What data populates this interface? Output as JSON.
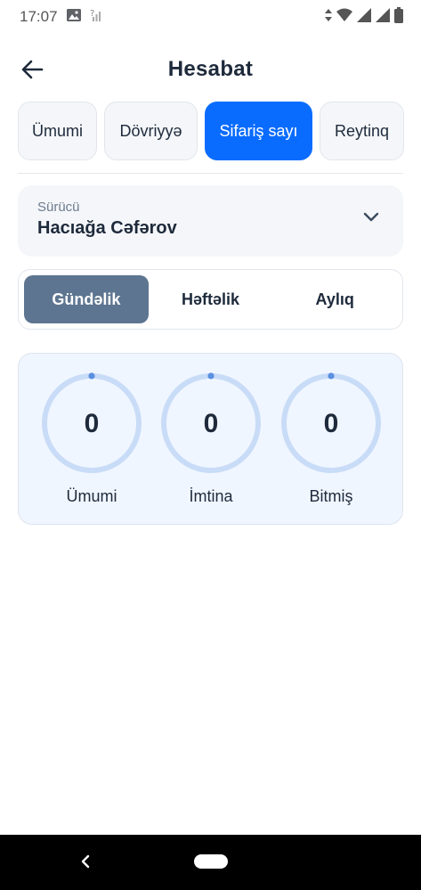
{
  "status_bar": {
    "time": "17:07"
  },
  "header": {
    "title": "Hesabat"
  },
  "tabs": [
    {
      "label": "Ümumi",
      "active": false
    },
    {
      "label": "Dövriyyə",
      "active": false
    },
    {
      "label": "Sifariş sayı",
      "active": true
    },
    {
      "label": "Reytinq",
      "active": false
    }
  ],
  "driver": {
    "label": "Sürücü",
    "value": "Hacıağa Cəfərov"
  },
  "period": {
    "options": [
      "Gündəlik",
      "Həftəlik",
      "Aylıq"
    ],
    "selected": "Gündəlik"
  },
  "stats": [
    {
      "label": "Ümumi",
      "value": "0"
    },
    {
      "label": "İmtina",
      "value": "0"
    },
    {
      "label": "Bitmiş",
      "value": "0"
    }
  ],
  "colors": {
    "accent": "#0a6cff",
    "period_active": "#5d7590",
    "ring_track": "#c9dcf7",
    "ring_dot": "#5b8fe0"
  }
}
